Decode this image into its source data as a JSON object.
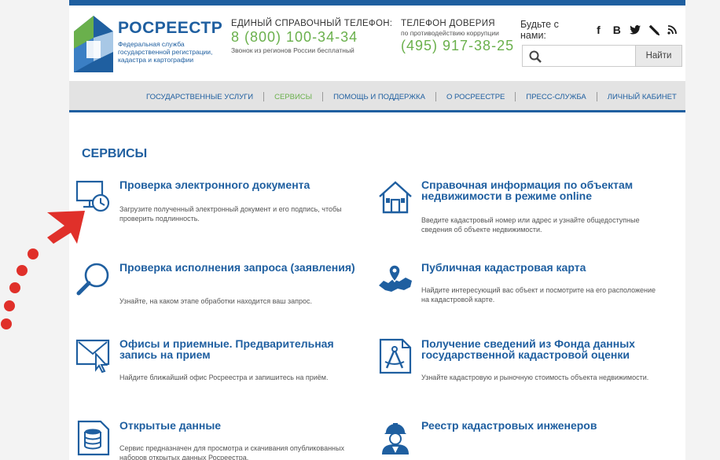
{
  "header": {
    "logo_title": "РОСРЕЕСТР",
    "logo_subtitle": "Федеральная служба государственной регистрации, кадастра и картографии",
    "phone1_title": "ЕДИНЫЙ СПРАВОЧНЫЙ ТЕЛЕФОН:",
    "phone1_number": "8 (800) 100-34-34",
    "phone1_note": "Звонок из регионов России бесплатный",
    "phone2_title": "ТЕЛЕФОН ДОВЕРИЯ",
    "phone2_subtitle": "по противодействию коррупции",
    "phone2_number": "(495) 917-38-25",
    "social_label": "Будьте с нами:",
    "social_icons": [
      "facebook-icon",
      "vk-icon",
      "twitter-icon",
      "livejournal-icon",
      "rss-icon"
    ],
    "search_placeholder": "",
    "search_button": "Найти"
  },
  "nav": {
    "items": [
      {
        "label": "ГОСУДАРСТВЕННЫЕ УСЛУГИ"
      },
      {
        "label": "СЕРВИСЫ"
      },
      {
        "label": "ПОМОЩЬ И ПОДДЕРЖКА"
      },
      {
        "label": "О РОСРЕЕСТРЕ"
      },
      {
        "label": "ПРЕСС-СЛУЖБА"
      },
      {
        "label": "ЛИЧНЫЙ КАБИНЕТ"
      }
    ],
    "active_index": 1
  },
  "main": {
    "title": "СЕРВИСЫ",
    "services": [
      {
        "title": "Проверка электронного документа",
        "desc": "Загрузите полученный электронный документ и его подпись, чтобы проверить подлинность.",
        "icon": "monitor-clock-icon"
      },
      {
        "title": "Справочная информация по объектам недвижимости в режиме online",
        "desc": "Введите кадастровый номер или адрес и узнайте общедоступные сведения об объекте недвижимости.",
        "icon": "house-icon"
      },
      {
        "title": "Проверка исполнения запроса (заявления)",
        "desc": "Узнайте, на каком этапе обработки находится ваш запрос.",
        "icon": "magnifier-icon"
      },
      {
        "title": "Публичная кадастровая карта",
        "desc": "Найдите интересующий вас объект и посмотрите на его расположение на кадастровой карте.",
        "icon": "map-pin-icon"
      },
      {
        "title": "Офисы и приемные. Предварительная запись на прием",
        "desc": "Найдите ближайший офис Росреестра и запишитесь на приём.",
        "icon": "cursor-icon"
      },
      {
        "title": "Получение сведений из Фонда данных государственной кадастровой оценки",
        "desc": "Узнайте кадастровую и рыночную стоимость объекта недвижимости.",
        "icon": "compass-document-icon"
      },
      {
        "title": "Открытые данные",
        "desc": "Сервис предназначен для просмотра и скачивания опубликованных наборов открытых данных Росреестра.",
        "icon": "database-document-icon"
      },
      {
        "title": "Реестр кадастровых инженеров",
        "desc": "",
        "icon": "engineer-icon"
      }
    ]
  },
  "colors": {
    "brand": "#1f5fa0",
    "accent_green": "#6ab04c",
    "annotation_red": "#e0302a"
  }
}
